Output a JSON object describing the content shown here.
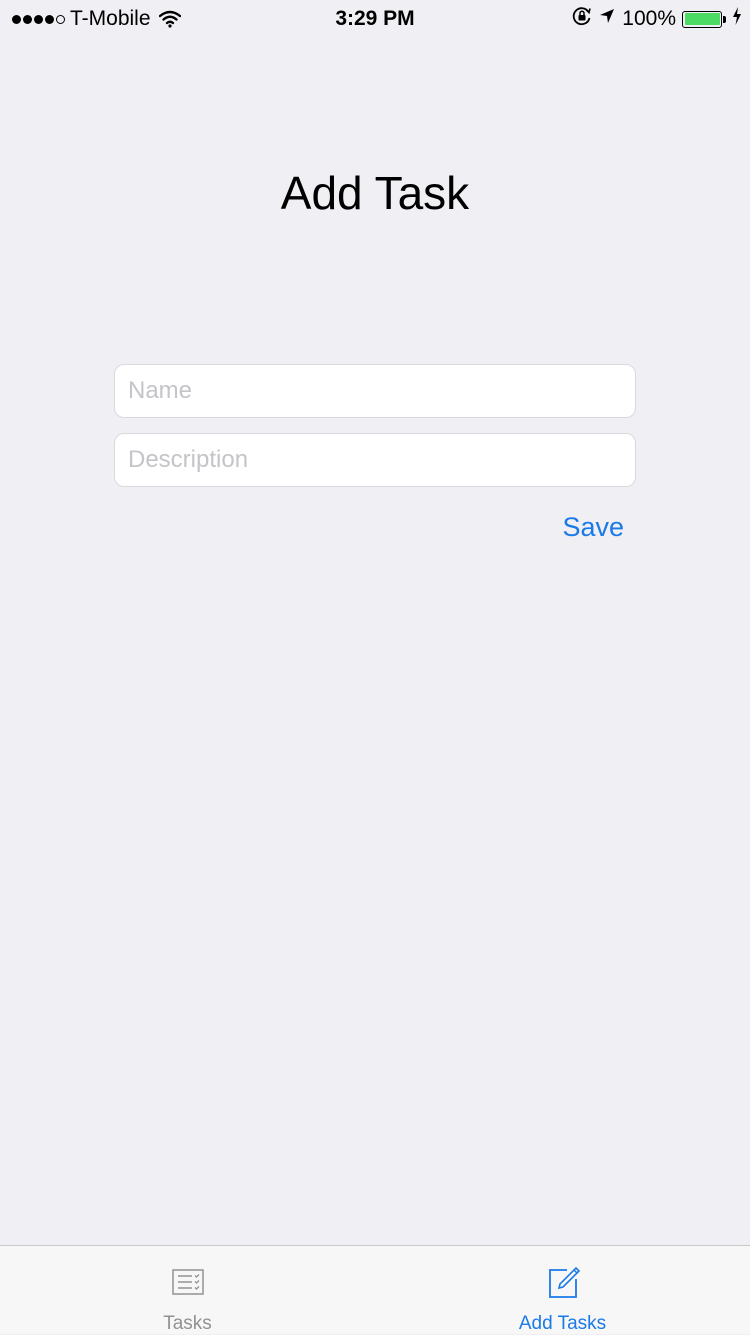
{
  "status_bar": {
    "carrier": "T-Mobile",
    "time": "3:29 PM",
    "battery_percent": "100%",
    "signal_bars_filled": 4,
    "signal_bars_total": 5,
    "battery_level": 1.0,
    "icons": [
      "wifi-icon",
      "orientation-lock-icon",
      "location-arrow-icon",
      "battery-icon",
      "charging-bolt-icon"
    ]
  },
  "page": {
    "title": "Add Task"
  },
  "form": {
    "name_placeholder": "Name",
    "name_value": "",
    "description_placeholder": "Description",
    "description_value": "",
    "save_label": "Save"
  },
  "tab_bar": {
    "tabs": [
      {
        "label": "Tasks",
        "icon": "task-list-icon",
        "selected": false
      },
      {
        "label": "Add Tasks",
        "icon": "compose-icon",
        "selected": true
      }
    ]
  },
  "colors": {
    "background": "#efeff4",
    "accent": "#1a7ae8",
    "tab_inactive": "#929292",
    "battery": "#4cd964"
  }
}
